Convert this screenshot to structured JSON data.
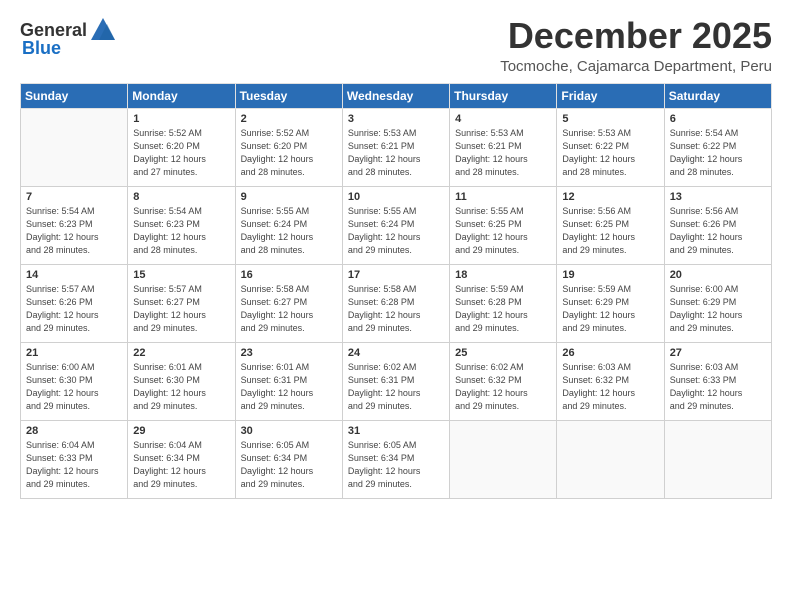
{
  "logo": {
    "general": "General",
    "blue": "Blue"
  },
  "header": {
    "month": "December 2025",
    "location": "Tocmoche, Cajamarca Department, Peru"
  },
  "weekdays": [
    "Sunday",
    "Monday",
    "Tuesday",
    "Wednesday",
    "Thursday",
    "Friday",
    "Saturday"
  ],
  "weeks": [
    [
      {
        "day": "",
        "info": ""
      },
      {
        "day": "1",
        "info": "Sunrise: 5:52 AM\nSunset: 6:20 PM\nDaylight: 12 hours\nand 27 minutes."
      },
      {
        "day": "2",
        "info": "Sunrise: 5:52 AM\nSunset: 6:20 PM\nDaylight: 12 hours\nand 28 minutes."
      },
      {
        "day": "3",
        "info": "Sunrise: 5:53 AM\nSunset: 6:21 PM\nDaylight: 12 hours\nand 28 minutes."
      },
      {
        "day": "4",
        "info": "Sunrise: 5:53 AM\nSunset: 6:21 PM\nDaylight: 12 hours\nand 28 minutes."
      },
      {
        "day": "5",
        "info": "Sunrise: 5:53 AM\nSunset: 6:22 PM\nDaylight: 12 hours\nand 28 minutes."
      },
      {
        "day": "6",
        "info": "Sunrise: 5:54 AM\nSunset: 6:22 PM\nDaylight: 12 hours\nand 28 minutes."
      }
    ],
    [
      {
        "day": "7",
        "info": "Sunrise: 5:54 AM\nSunset: 6:23 PM\nDaylight: 12 hours\nand 28 minutes."
      },
      {
        "day": "8",
        "info": "Sunrise: 5:54 AM\nSunset: 6:23 PM\nDaylight: 12 hours\nand 28 minutes."
      },
      {
        "day": "9",
        "info": "Sunrise: 5:55 AM\nSunset: 6:24 PM\nDaylight: 12 hours\nand 28 minutes."
      },
      {
        "day": "10",
        "info": "Sunrise: 5:55 AM\nSunset: 6:24 PM\nDaylight: 12 hours\nand 29 minutes."
      },
      {
        "day": "11",
        "info": "Sunrise: 5:55 AM\nSunset: 6:25 PM\nDaylight: 12 hours\nand 29 minutes."
      },
      {
        "day": "12",
        "info": "Sunrise: 5:56 AM\nSunset: 6:25 PM\nDaylight: 12 hours\nand 29 minutes."
      },
      {
        "day": "13",
        "info": "Sunrise: 5:56 AM\nSunset: 6:26 PM\nDaylight: 12 hours\nand 29 minutes."
      }
    ],
    [
      {
        "day": "14",
        "info": "Sunrise: 5:57 AM\nSunset: 6:26 PM\nDaylight: 12 hours\nand 29 minutes."
      },
      {
        "day": "15",
        "info": "Sunrise: 5:57 AM\nSunset: 6:27 PM\nDaylight: 12 hours\nand 29 minutes."
      },
      {
        "day": "16",
        "info": "Sunrise: 5:58 AM\nSunset: 6:27 PM\nDaylight: 12 hours\nand 29 minutes."
      },
      {
        "day": "17",
        "info": "Sunrise: 5:58 AM\nSunset: 6:28 PM\nDaylight: 12 hours\nand 29 minutes."
      },
      {
        "day": "18",
        "info": "Sunrise: 5:59 AM\nSunset: 6:28 PM\nDaylight: 12 hours\nand 29 minutes."
      },
      {
        "day": "19",
        "info": "Sunrise: 5:59 AM\nSunset: 6:29 PM\nDaylight: 12 hours\nand 29 minutes."
      },
      {
        "day": "20",
        "info": "Sunrise: 6:00 AM\nSunset: 6:29 PM\nDaylight: 12 hours\nand 29 minutes."
      }
    ],
    [
      {
        "day": "21",
        "info": "Sunrise: 6:00 AM\nSunset: 6:30 PM\nDaylight: 12 hours\nand 29 minutes."
      },
      {
        "day": "22",
        "info": "Sunrise: 6:01 AM\nSunset: 6:30 PM\nDaylight: 12 hours\nand 29 minutes."
      },
      {
        "day": "23",
        "info": "Sunrise: 6:01 AM\nSunset: 6:31 PM\nDaylight: 12 hours\nand 29 minutes."
      },
      {
        "day": "24",
        "info": "Sunrise: 6:02 AM\nSunset: 6:31 PM\nDaylight: 12 hours\nand 29 minutes."
      },
      {
        "day": "25",
        "info": "Sunrise: 6:02 AM\nSunset: 6:32 PM\nDaylight: 12 hours\nand 29 minutes."
      },
      {
        "day": "26",
        "info": "Sunrise: 6:03 AM\nSunset: 6:32 PM\nDaylight: 12 hours\nand 29 minutes."
      },
      {
        "day": "27",
        "info": "Sunrise: 6:03 AM\nSunset: 6:33 PM\nDaylight: 12 hours\nand 29 minutes."
      }
    ],
    [
      {
        "day": "28",
        "info": "Sunrise: 6:04 AM\nSunset: 6:33 PM\nDaylight: 12 hours\nand 29 minutes."
      },
      {
        "day": "29",
        "info": "Sunrise: 6:04 AM\nSunset: 6:34 PM\nDaylight: 12 hours\nand 29 minutes."
      },
      {
        "day": "30",
        "info": "Sunrise: 6:05 AM\nSunset: 6:34 PM\nDaylight: 12 hours\nand 29 minutes."
      },
      {
        "day": "31",
        "info": "Sunrise: 6:05 AM\nSunset: 6:34 PM\nDaylight: 12 hours\nand 29 minutes."
      },
      {
        "day": "",
        "info": ""
      },
      {
        "day": "",
        "info": ""
      },
      {
        "day": "",
        "info": ""
      }
    ]
  ]
}
